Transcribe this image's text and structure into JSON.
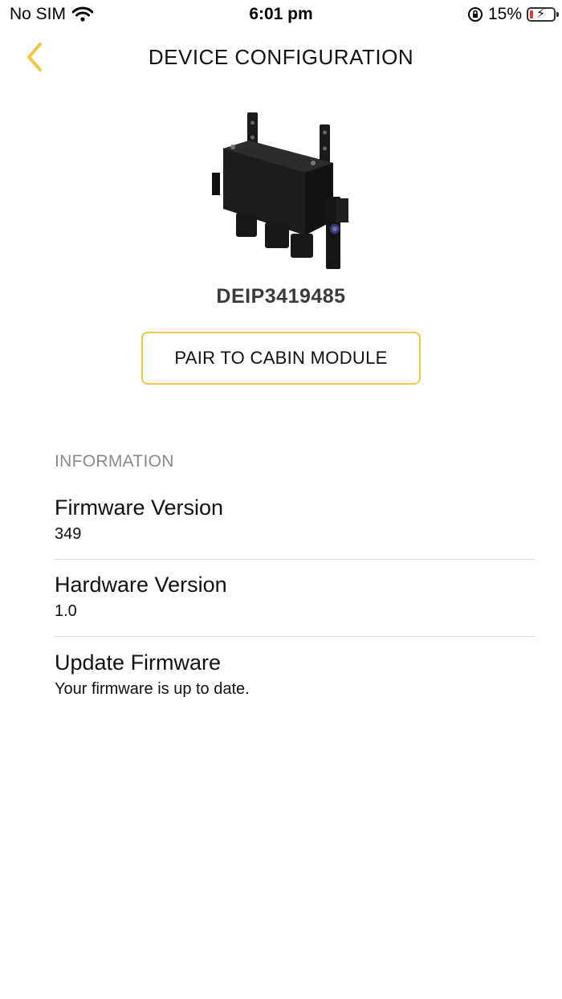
{
  "status_bar": {
    "carrier": "No SIM",
    "time": "6:01 pm",
    "battery_percent": "15%",
    "battery_level": 0.15,
    "battery_color": "#e53935"
  },
  "nav": {
    "title": "DEVICE CONFIGURATION",
    "back_icon": "chevron-left-icon",
    "accent": "#f2c744"
  },
  "device": {
    "id": "DEIP3419485",
    "image": "control-module-image"
  },
  "pair_button": {
    "label": "PAIR TO CABIN MODULE"
  },
  "information": {
    "header": "INFORMATION",
    "rows": [
      {
        "title": "Firmware Version",
        "value": "349"
      },
      {
        "title": "Hardware Version",
        "value": "1.0"
      },
      {
        "title": "Update Firmware",
        "value": "Your firmware is up to date."
      }
    ]
  }
}
